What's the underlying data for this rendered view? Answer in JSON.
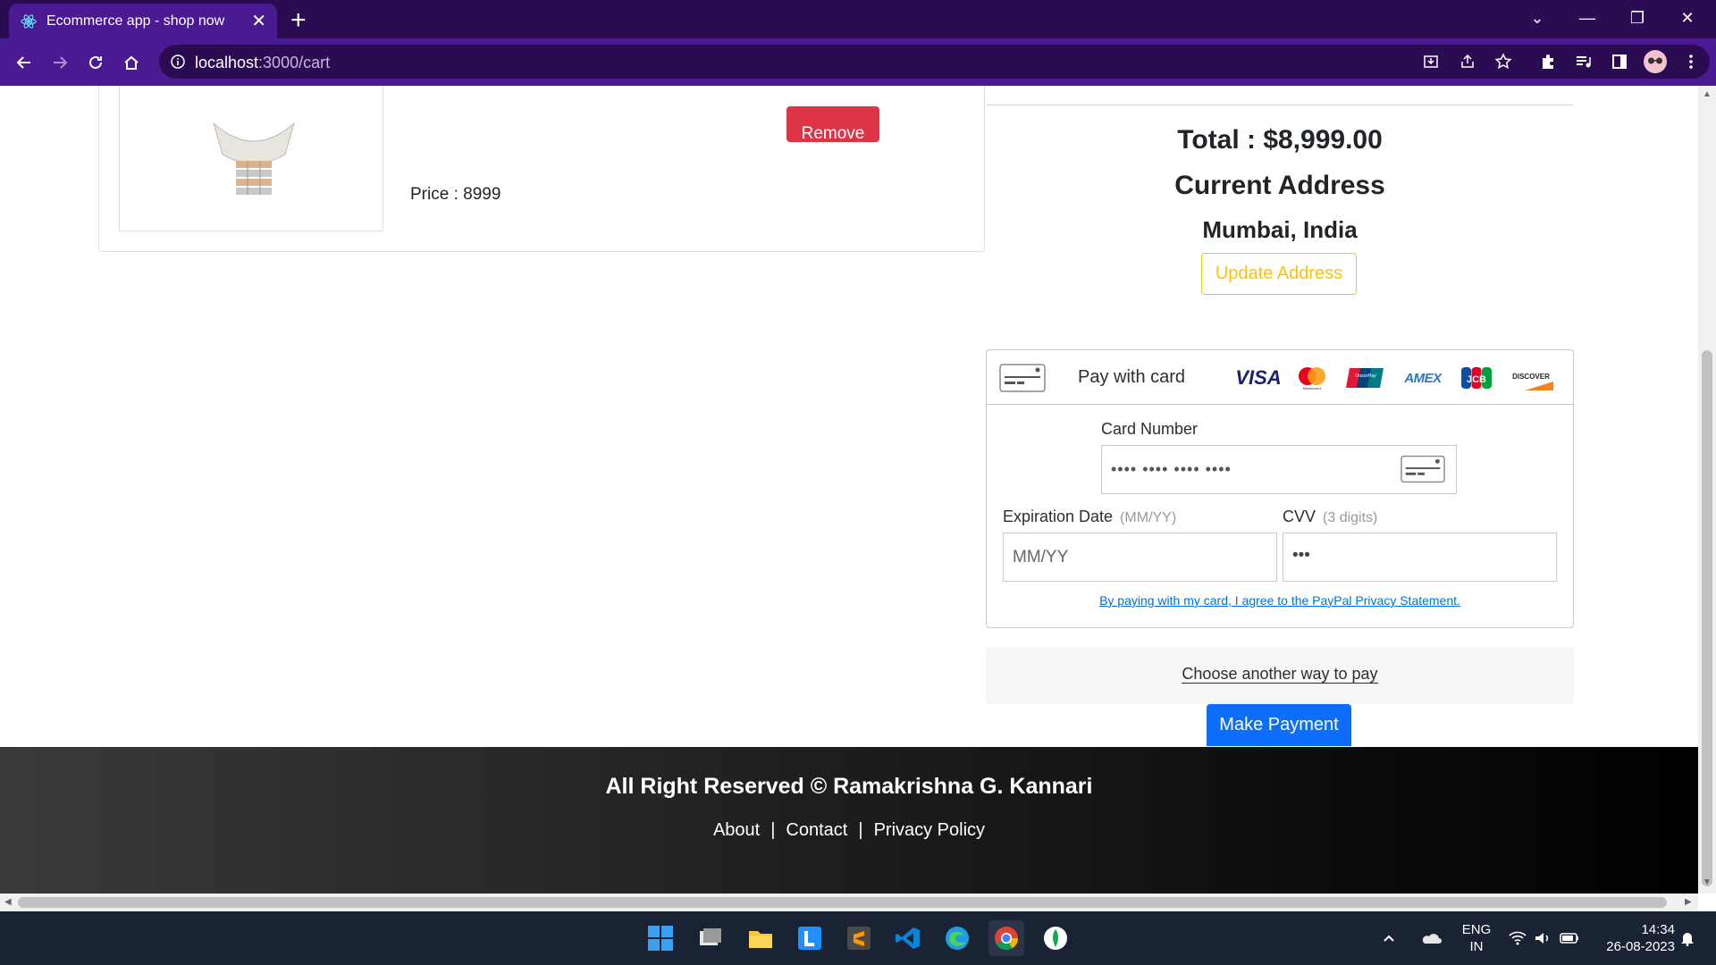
{
  "browser": {
    "tab_title": "Ecommerce app - shop now",
    "url_host": "localhost",
    "url_path": ":3000/cart"
  },
  "cart": {
    "price_label": "Price : 8999",
    "remove_label": "Remove"
  },
  "summary": {
    "total": "Total : $8,999.00",
    "address_heading": "Current Address",
    "address_value": "Mumbai, India",
    "update_address_label": "Update Address"
  },
  "payment": {
    "pay_with_card": "Pay with card",
    "brands": [
      "VISA",
      "Mastercard",
      "UnionPay",
      "AMEX",
      "JCB",
      "DISCOVER"
    ],
    "card_number_label": "Card Number",
    "card_number_placeholder": "•••• •••• •••• ••••",
    "expiration_label": "Expiration Date",
    "expiration_hint": "(MM/YY)",
    "expiration_placeholder": "MM/YY",
    "cvv_label": "CVV",
    "cvv_hint": "(3 digits)",
    "cvv_placeholder": "•••",
    "privacy_text": "By paying with my card, I agree to the PayPal Privacy Statement.",
    "other_way": "Choose another way to pay",
    "make_payment": "Make Payment"
  },
  "footer": {
    "title": "All Right Reserved © Ramakrishna G. Kannari",
    "links": [
      "About",
      "Contact",
      "Privacy Policy"
    ],
    "separator": "|"
  },
  "taskbar": {
    "lang_line1": "ENG",
    "lang_line2": "IN",
    "time": "14:34",
    "date": "26-08-2023"
  },
  "colors": {
    "browser_frame": "#2b0c52",
    "browser_toolbar": "#4a1a93",
    "remove_red": "#dc3545",
    "update_yellow": "#ffc107",
    "primary_blue": "#0d6efd",
    "paypal_link": "#0070e0"
  }
}
